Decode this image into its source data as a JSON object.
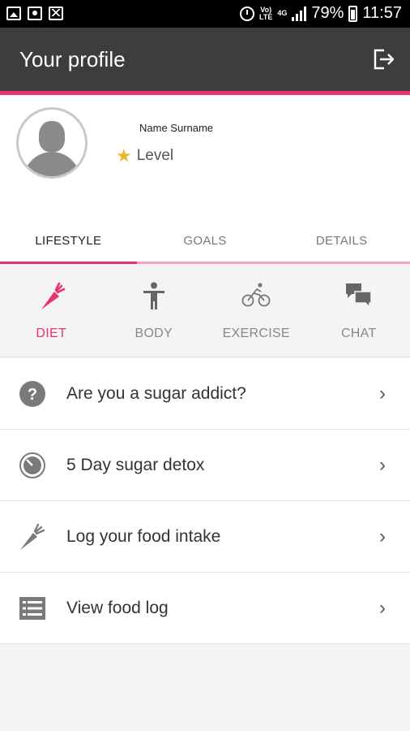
{
  "status_bar": {
    "carrier_lines": [
      "Vo)",
      "LTE"
    ],
    "network": "4G",
    "battery": "79%",
    "time": "11:57"
  },
  "header": {
    "title": "Your profile"
  },
  "profile": {
    "name": "Name Surname",
    "level": "Level"
  },
  "tabs": [
    {
      "label": "LIFESTYLE",
      "active": true
    },
    {
      "label": "GOALS",
      "active": false
    },
    {
      "label": "DETAILS",
      "active": false
    }
  ],
  "subtabs": [
    {
      "label": "DIET",
      "icon": "carrot-icon",
      "active": true
    },
    {
      "label": "BODY",
      "icon": "person-icon",
      "active": false
    },
    {
      "label": "EXERCISE",
      "icon": "bicycle-icon",
      "active": false
    },
    {
      "label": "CHAT",
      "icon": "chat-icon",
      "active": false
    }
  ],
  "list": [
    {
      "label": "Are you a sugar addict?",
      "icon": "question-icon"
    },
    {
      "label": "5 Day sugar detox",
      "icon": "timer-icon"
    },
    {
      "label": "Log your food intake",
      "icon": "carrot-icon"
    },
    {
      "label": "View food log",
      "icon": "list-icon"
    }
  ],
  "colors": {
    "accent": "#e8336c",
    "appbar": "#3d3d3d",
    "star": "#f0b429"
  }
}
